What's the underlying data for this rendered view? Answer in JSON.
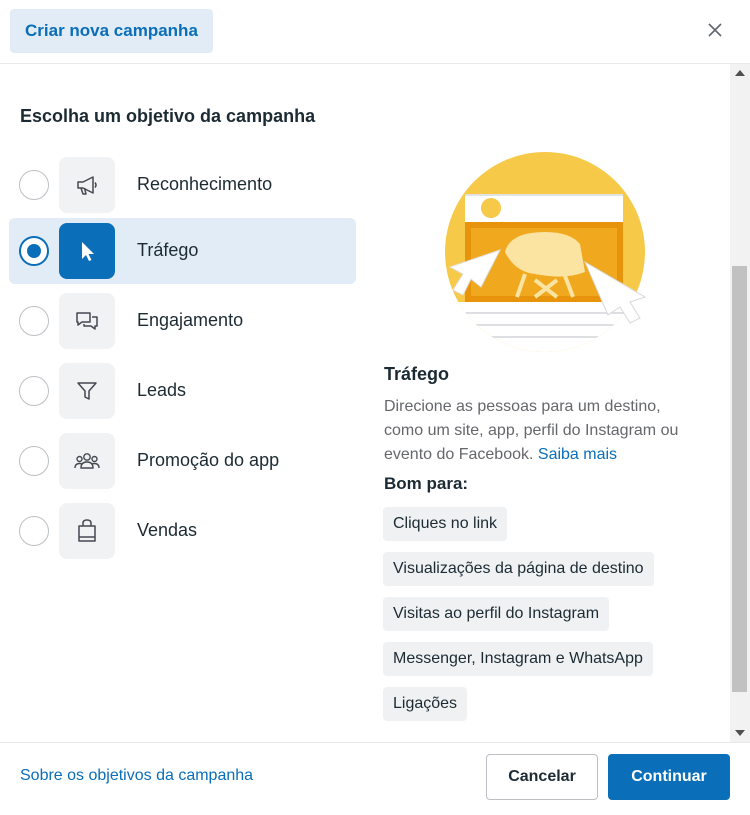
{
  "header": {
    "title": "Criar nova campanha",
    "close_icon": "close-icon"
  },
  "section_title": "Escolha um objetivo da campanha",
  "objectives": [
    {
      "label": "Reconhecimento",
      "icon": "megaphone-icon",
      "selected": false
    },
    {
      "label": "Tráfego",
      "icon": "cursor-icon",
      "selected": true
    },
    {
      "label": "Engajamento",
      "icon": "chat-bubbles-icon",
      "selected": false
    },
    {
      "label": "Leads",
      "icon": "filter-icon",
      "selected": false
    },
    {
      "label": "Promoção do app",
      "icon": "people-icon",
      "selected": false
    },
    {
      "label": "Vendas",
      "icon": "shopping-bag-icon",
      "selected": false
    }
  ],
  "detail": {
    "title": "Tráfego",
    "description": "Direcione as pessoas para um destino, como um site, app, perfil do Instagram ou evento do Facebook.",
    "learn_more": "Saiba mais",
    "good_for_label": "Bom para:",
    "tags": [
      "Cliques no link",
      "Visualizações da página de destino",
      "Visitas ao perfil do Instagram",
      "Messenger, Instagram e WhatsApp",
      "Ligações"
    ]
  },
  "footer": {
    "link": "Sobre os objetivos da campanha",
    "cancel": "Cancelar",
    "continue": "Continuar"
  },
  "colors": {
    "accent": "#0a6eb8",
    "selected_bg": "#e1ecf7",
    "illustration_yellow": "#f7c948",
    "illustration_orange": "#e8930c"
  }
}
